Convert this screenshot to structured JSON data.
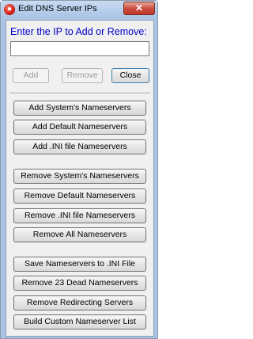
{
  "window": {
    "title": "Edit DNS Server IPs",
    "close_glyph": "✕",
    "app_icon": "dns-app-icon"
  },
  "prompt_label": "Enter the IP to Add or Remove:",
  "ip_input": {
    "value": "",
    "placeholder": ""
  },
  "top_buttons": {
    "add": "Add",
    "remove": "Remove",
    "close": "Close"
  },
  "group1": [
    "Add System's Nameservers",
    "Add Default Nameservers",
    "Add .INI file Nameservers"
  ],
  "group2": [
    "Remove System's Nameservers",
    "Remove Default Nameservers",
    "Remove .INI file Nameservers",
    "Remove All Nameservers"
  ],
  "group3": [
    "Save Nameservers to .INI File",
    "Remove 23 Dead Nameservers",
    "Remove Redirecting Servers",
    "Build Custom Nameserver List"
  ]
}
